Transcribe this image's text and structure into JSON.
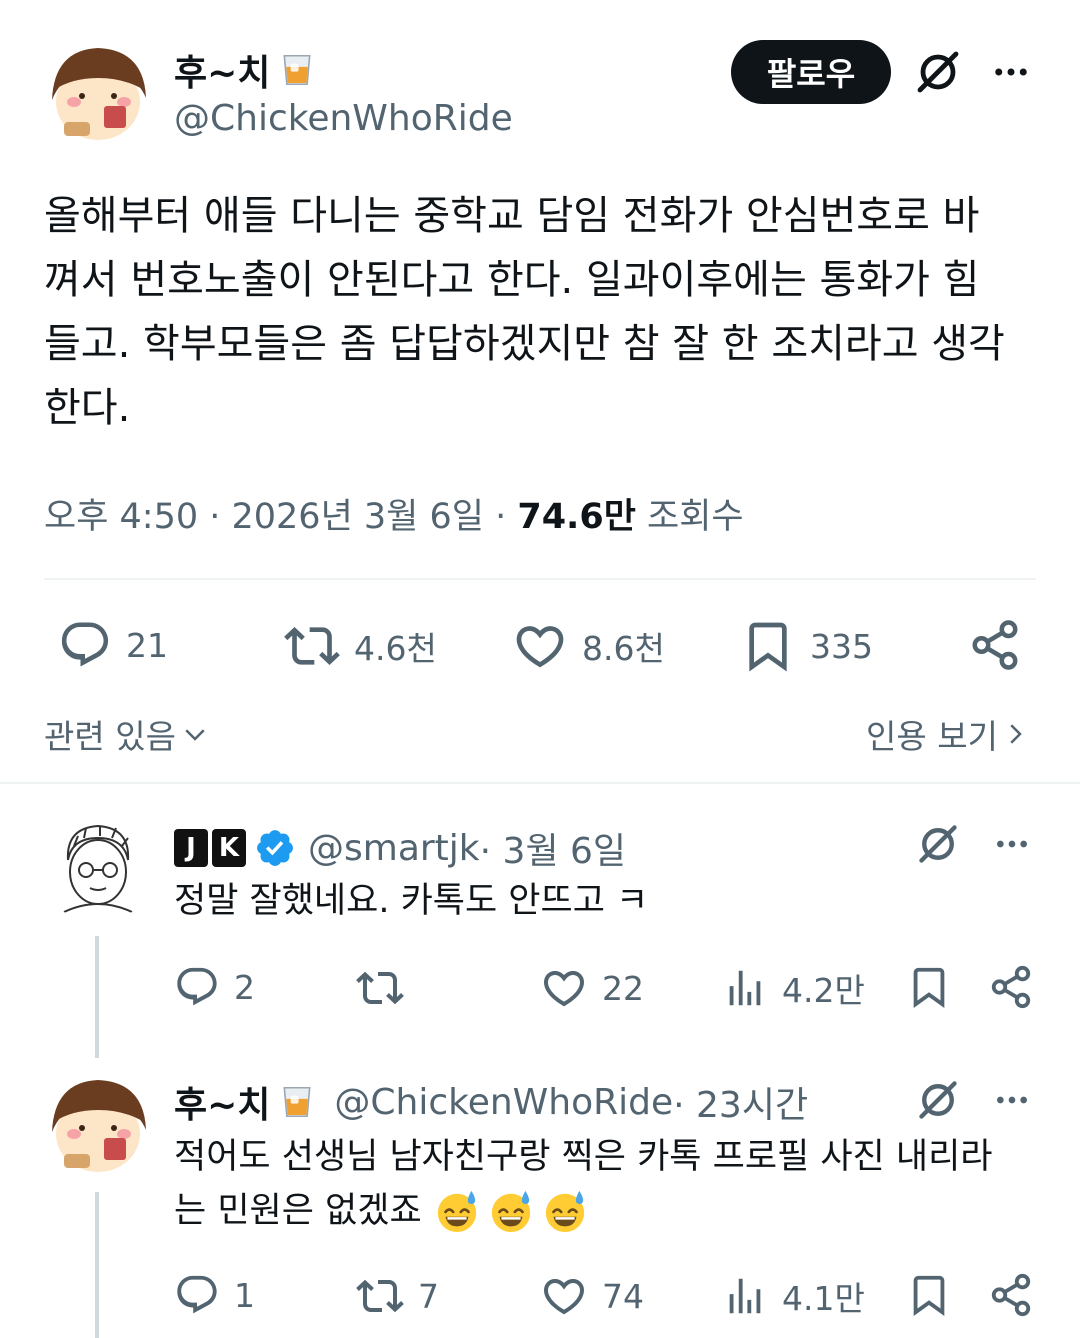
{
  "main_tweet": {
    "author_name": "후~치",
    "author_handle": "@ChickenWhoRide",
    "follow_label": "팔로우",
    "text_lines": [
      "올해부터 애들 다니는 중학교 담임 전화가 안심번호로 바",
      "껴서 번호노출이 안된다고 한다. 일과이후에는 통화가 힘",
      "들고. 학부모들은 좀 답답하겠지만 참 잘 한 조치라고 생각",
      "한다."
    ],
    "time": "오후 4:50 · 2026년 3월 6일 · ",
    "views_count": "74.6만",
    "views_label": " 조회수",
    "stats": {
      "replies": "21",
      "reposts": "4.6천",
      "likes": "8.6천",
      "bookmarks": "335"
    },
    "related_label": "관련 있음",
    "quotes_label": "인용 보기"
  },
  "replies": [
    {
      "badge_letters": [
        "J",
        "K"
      ],
      "handle": "@smartjk",
      "time": " · 3월 6일",
      "text": "정말 잘했네요. 카톡도 안뜨고 ㅋ",
      "stats": {
        "replies": "2",
        "reposts": "",
        "likes": "22",
        "views": "4.2만"
      }
    },
    {
      "author_name": "후~치",
      "handle": "@ChickenWhoRide",
      "time": " · 23시간",
      "text_line1": "적어도 선생님 남자친구랑 찍은 카톡 프로필 사진 내리라",
      "text_line2": "는 민원은 없겠죠",
      "stats": {
        "replies": "1",
        "reposts": "7",
        "likes": "74",
        "views": "4.1만"
      }
    }
  ],
  "icons": {
    "grok": "grok-slash-icon",
    "more": "more-dots-icon",
    "reply": "reply-bubble-icon",
    "repost": "repost-icon",
    "like": "heart-icon",
    "bookmark": "bookmark-icon",
    "share": "share-icon",
    "views": "views-bars-icon",
    "verified": "verified-badge-icon",
    "drink": "whiskey-glass-emoji",
    "sweat_smile": "sweat-smile-emoji"
  },
  "colors": {
    "text": "#0f1419",
    "secondary": "#536471",
    "verified": "#1d9bf0",
    "divider": "#eff3f4"
  }
}
